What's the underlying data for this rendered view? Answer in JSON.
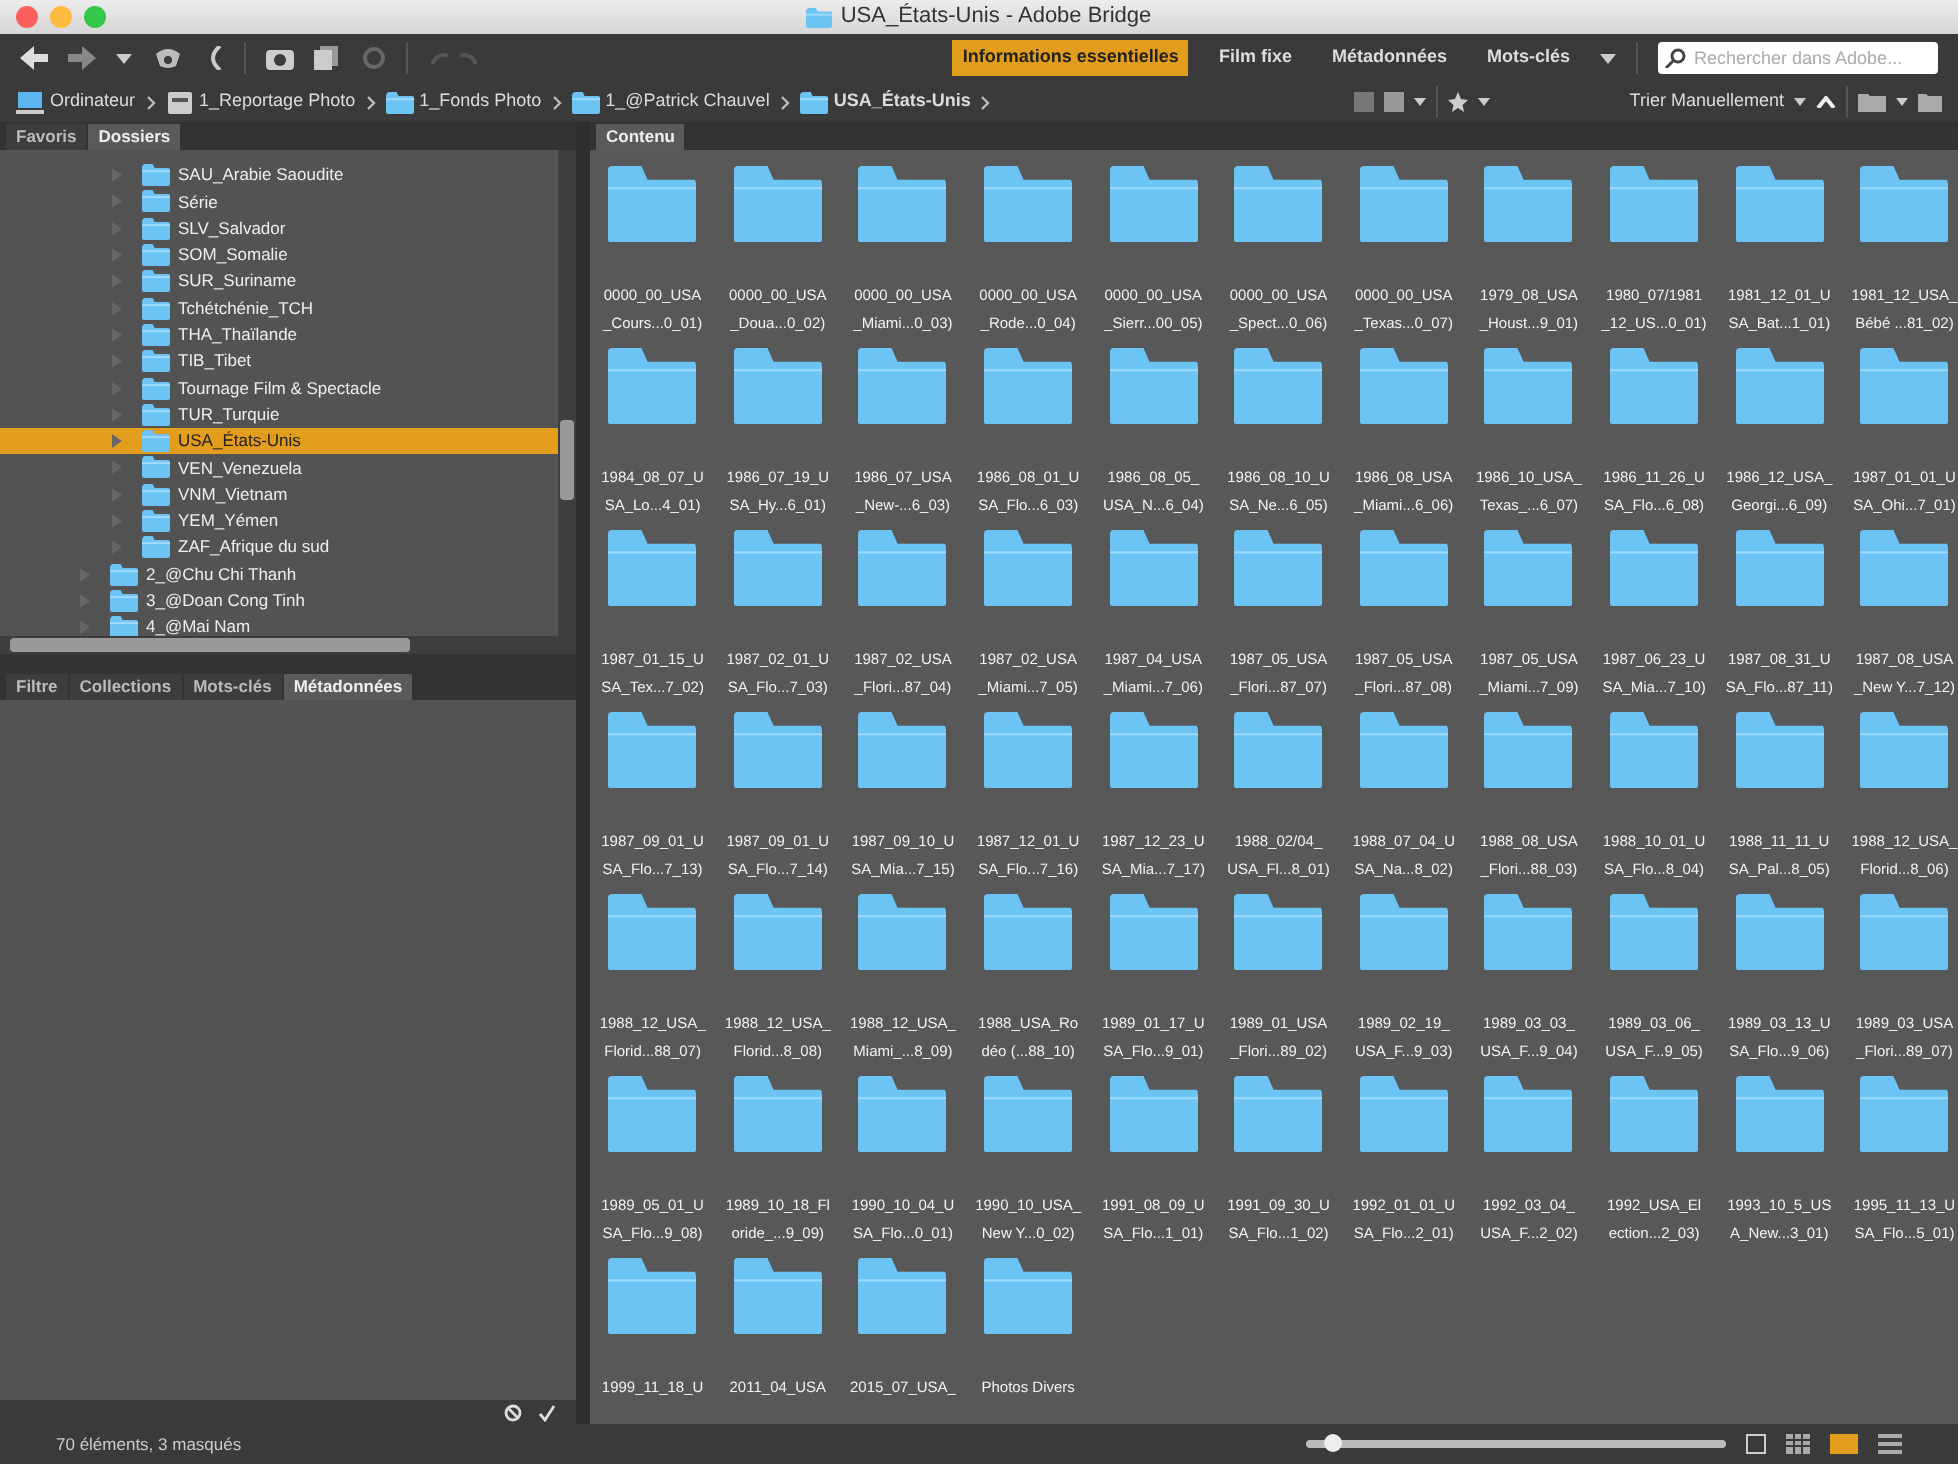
{
  "window": {
    "title": "USA_États-Unis - Adobe Bridge"
  },
  "workspaces": [
    {
      "label": "Informations essentielles",
      "selected": true
    },
    {
      "label": "Film fixe",
      "selected": false
    },
    {
      "label": "Métadonnées",
      "selected": false
    },
    {
      "label": "Mots-clés",
      "selected": false
    }
  ],
  "search": {
    "placeholder": "Rechercher dans Adobe..."
  },
  "path": [
    {
      "label": "Ordinateur",
      "kind": "computer"
    },
    {
      "label": "1_Reportage Photo",
      "kind": "drive"
    },
    {
      "label": "1_Fonds Photo",
      "kind": "folder"
    },
    {
      "label": "1_@Patrick Chauvel",
      "kind": "folder"
    },
    {
      "label": "USA_États-Unis",
      "kind": "folder"
    }
  ],
  "sort": {
    "label": "Trier Manuellement"
  },
  "top_panel_tabs": [
    {
      "label": "Favoris",
      "selected": false
    },
    {
      "label": "Dossiers",
      "selected": true
    }
  ],
  "tree": [
    {
      "children": [
        {
          "label": "SAU_Arabie Saoudite",
          "selected": false
        },
        {
          "label": "Série",
          "selected": false
        },
        {
          "label": "SLV_Salvador",
          "selected": false
        },
        {
          "label": "SOM_Somalie",
          "selected": false
        },
        {
          "label": "SUR_Suriname",
          "selected": false
        },
        {
          "label": "Tchétchénie_TCH",
          "selected": false
        },
        {
          "label": "THA_Thaïlande",
          "selected": false
        },
        {
          "label": "TIB_Tibet",
          "selected": false
        },
        {
          "label": "Tournage Film & Spectacle",
          "selected": false
        },
        {
          "label": "TUR_Turquie",
          "selected": false
        },
        {
          "label": "USA_États-Unis",
          "selected": true
        },
        {
          "label": "VEN_Venezuela",
          "selected": false
        },
        {
          "label": "VNM_Vietnam",
          "selected": false
        },
        {
          "label": "YEM_Yémen",
          "selected": false
        },
        {
          "label": "ZAF_Afrique du sud",
          "selected": false
        }
      ]
    },
    {
      "label": "2_@Chu Chi Thanh",
      "selected": false
    },
    {
      "label": "3_@Doan Cong Tinh",
      "selected": false
    },
    {
      "label": "4_@Mai Nam",
      "selected": false
    }
  ],
  "bottom_panel_tabs": [
    {
      "label": "Filtre",
      "selected": false
    },
    {
      "label": "Collections",
      "selected": false
    },
    {
      "label": "Mots-clés",
      "selected": false
    },
    {
      "label": "Métadonnées",
      "selected": true
    }
  ],
  "content_tabs": [
    {
      "label": "Contenu",
      "selected": true
    }
  ],
  "items": [
    {
      "lines": [
        "0000_00_USA",
        "_Cours...0_01)"
      ]
    },
    {
      "lines": [
        "0000_00_USA",
        "_Doua...0_02)"
      ]
    },
    {
      "lines": [
        "0000_00_USA",
        "_Miami...0_03)"
      ]
    },
    {
      "lines": [
        "0000_00_USA",
        "_Rode...0_04)"
      ]
    },
    {
      "lines": [
        "0000_00_USA",
        "_Sierr...00_05)"
      ]
    },
    {
      "lines": [
        "0000_00_USA",
        "_Spect...0_06)"
      ]
    },
    {
      "lines": [
        "0000_00_USA",
        "_Texas...0_07)"
      ]
    },
    {
      "lines": [
        "1979_08_USA",
        "_Houst...9_01)"
      ]
    },
    {
      "lines": [
        "1980_07/1981",
        "_12_US...0_01)"
      ]
    },
    {
      "lines": [
        "1981_12_01_U",
        "SA_Bat...1_01)"
      ]
    },
    {
      "lines": [
        "1981_12_USA_",
        "Bébé ...81_02)"
      ]
    },
    {
      "lines": [
        "1984_08_07_U",
        "SA_Lo...4_01)"
      ]
    },
    {
      "lines": [
        "1986_07_19_U",
        "SA_Hy...6_01)"
      ]
    },
    {
      "lines": [
        "1986_07_USA",
        "_New-...6_03)"
      ]
    },
    {
      "lines": [
        "1986_08_01_U",
        "SA_Flo...6_03)"
      ]
    },
    {
      "lines": [
        "1986_08_05_",
        "USA_N...6_04)"
      ]
    },
    {
      "lines": [
        "1986_08_10_U",
        "SA_Ne...6_05)"
      ]
    },
    {
      "lines": [
        "1986_08_USA",
        "_Miami...6_06)"
      ]
    },
    {
      "lines": [
        "1986_10_USA_",
        "Texas_...6_07)"
      ]
    },
    {
      "lines": [
        "1986_11_26_U",
        "SA_Flo...6_08)"
      ]
    },
    {
      "lines": [
        "1986_12_USA_",
        "Georgi...6_09)"
      ]
    },
    {
      "lines": [
        "1987_01_01_U",
        "SA_Ohi...7_01)"
      ]
    },
    {
      "lines": [
        "1987_01_15_U",
        "SA_Tex...7_02)"
      ]
    },
    {
      "lines": [
        "1987_02_01_U",
        "SA_Flo...7_03)"
      ]
    },
    {
      "lines": [
        "1987_02_USA",
        "_Flori...87_04)"
      ]
    },
    {
      "lines": [
        "1987_02_USA",
        "_Miami...7_05)"
      ]
    },
    {
      "lines": [
        "1987_04_USA",
        "_Miami...7_06)"
      ]
    },
    {
      "lines": [
        "1987_05_USA",
        "_Flori...87_07)"
      ]
    },
    {
      "lines": [
        "1987_05_USA",
        "_Flori...87_08)"
      ]
    },
    {
      "lines": [
        "1987_05_USA",
        "_Miami...7_09)"
      ]
    },
    {
      "lines": [
        "1987_06_23_U",
        "SA_Mia...7_10)"
      ]
    },
    {
      "lines": [
        "1987_08_31_U",
        "SA_Flo...87_11)"
      ]
    },
    {
      "lines": [
        "1987_08_USA",
        "_New Y...7_12)"
      ]
    },
    {
      "lines": [
        "1987_09_01_U",
        "SA_Flo...7_13)"
      ]
    },
    {
      "lines": [
        "1987_09_01_U",
        "SA_Flo...7_14)"
      ]
    },
    {
      "lines": [
        "1987_09_10_U",
        "SA_Mia...7_15)"
      ]
    },
    {
      "lines": [
        "1987_12_01_U",
        "SA_Flo...7_16)"
      ]
    },
    {
      "lines": [
        "1987_12_23_U",
        "SA_Mia...7_17)"
      ]
    },
    {
      "lines": [
        "1988_02/04_",
        "USA_Fl...8_01)"
      ]
    },
    {
      "lines": [
        "1988_07_04_U",
        "SA_Na...8_02)"
      ]
    },
    {
      "lines": [
        "1988_08_USA",
        "_Flori...88_03)"
      ]
    },
    {
      "lines": [
        "1988_10_01_U",
        "SA_Flo...8_04)"
      ]
    },
    {
      "lines": [
        "1988_11_11_U",
        "SA_Pal...8_05)"
      ]
    },
    {
      "lines": [
        "1988_12_USA_",
        "Florid...8_06)"
      ]
    },
    {
      "lines": [
        "1988_12_USA_",
        "Florid...88_07)"
      ]
    },
    {
      "lines": [
        "1988_12_USA_",
        "Florid...8_08)"
      ]
    },
    {
      "lines": [
        "1988_12_USA_",
        "Miami_...8_09)"
      ]
    },
    {
      "lines": [
        "1988_USA_Ro",
        "déo (...88_10)"
      ]
    },
    {
      "lines": [
        "1989_01_17_U",
        "SA_Flo...9_01)"
      ]
    },
    {
      "lines": [
        "1989_01_USA",
        "_Flori...89_02)"
      ]
    },
    {
      "lines": [
        "1989_02_19_",
        "USA_F...9_03)"
      ]
    },
    {
      "lines": [
        "1989_03_03_",
        "USA_F...9_04)"
      ]
    },
    {
      "lines": [
        "1989_03_06_",
        "USA_F...9_05)"
      ]
    },
    {
      "lines": [
        "1989_03_13_U",
        "SA_Flo...9_06)"
      ]
    },
    {
      "lines": [
        "1989_03_USA",
        "_Flori...89_07)"
      ]
    },
    {
      "lines": [
        "1989_05_01_U",
        "SA_Flo...9_08)"
      ]
    },
    {
      "lines": [
        "1989_10_18_Fl",
        "oride_...9_09)"
      ]
    },
    {
      "lines": [
        "1990_10_04_U",
        "SA_Flo...0_01)"
      ]
    },
    {
      "lines": [
        "1990_10_USA_",
        "New Y...0_02)"
      ]
    },
    {
      "lines": [
        "1991_08_09_U",
        "SA_Flo...1_01)"
      ]
    },
    {
      "lines": [
        "1991_09_30_U",
        "SA_Flo...1_02)"
      ]
    },
    {
      "lines": [
        "1992_01_01_U",
        "SA_Flo...2_01)"
      ]
    },
    {
      "lines": [
        "1992_03_04_",
        "USA_F...2_02)"
      ]
    },
    {
      "lines": [
        "1992_USA_El",
        "ection...2_03)"
      ]
    },
    {
      "lines": [
        "1993_10_5_US",
        "A_New...3_01)"
      ]
    },
    {
      "lines": [
        "1995_11_13_U",
        "SA_Flo...5_01)"
      ]
    },
    {
      "lines": [
        "1999_11_18_U"
      ]
    },
    {
      "lines": [
        "2011_04_USA"
      ]
    },
    {
      "lines": [
        "2015_07_USA_"
      ]
    },
    {
      "lines": [
        "Photos Divers"
      ]
    }
  ],
  "status": {
    "text": "70 éléments, 3 masqués"
  },
  "thumbnail_slider": {
    "level": 0.06
  }
}
